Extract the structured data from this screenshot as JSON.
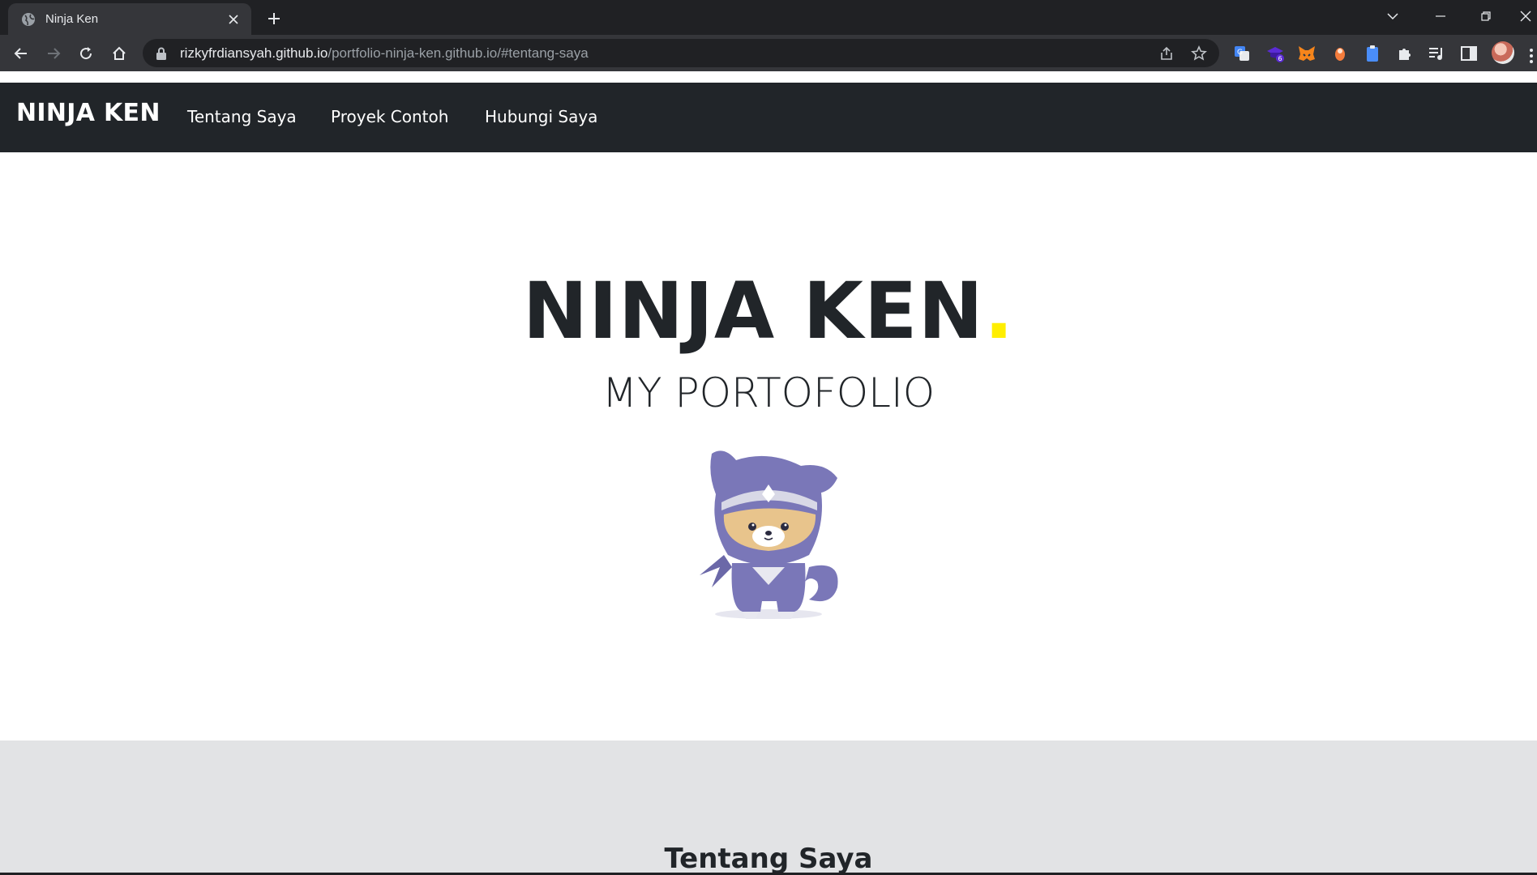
{
  "browser": {
    "tab_title": "Ninja Ken",
    "url_host": "rizkyfrdiansyah.github.io",
    "url_path": "/portfolio-ninja-ken.github.io/#tentang-saya",
    "extension_badge": "6"
  },
  "navbar": {
    "brand": "NINJA KEN",
    "links": [
      "Tentang Saya",
      "Proyek Contoh",
      "Hubungi Saya"
    ]
  },
  "hero": {
    "title": "NINJA KEN",
    "title_dot": ".",
    "subtitle": "MY PORTOFOLIO"
  },
  "about": {
    "heading": "Tentang Saya"
  },
  "colors": {
    "navbar_bg": "#212529",
    "accent_dot": "#ffee00",
    "about_bg": "#e2e3e5"
  }
}
